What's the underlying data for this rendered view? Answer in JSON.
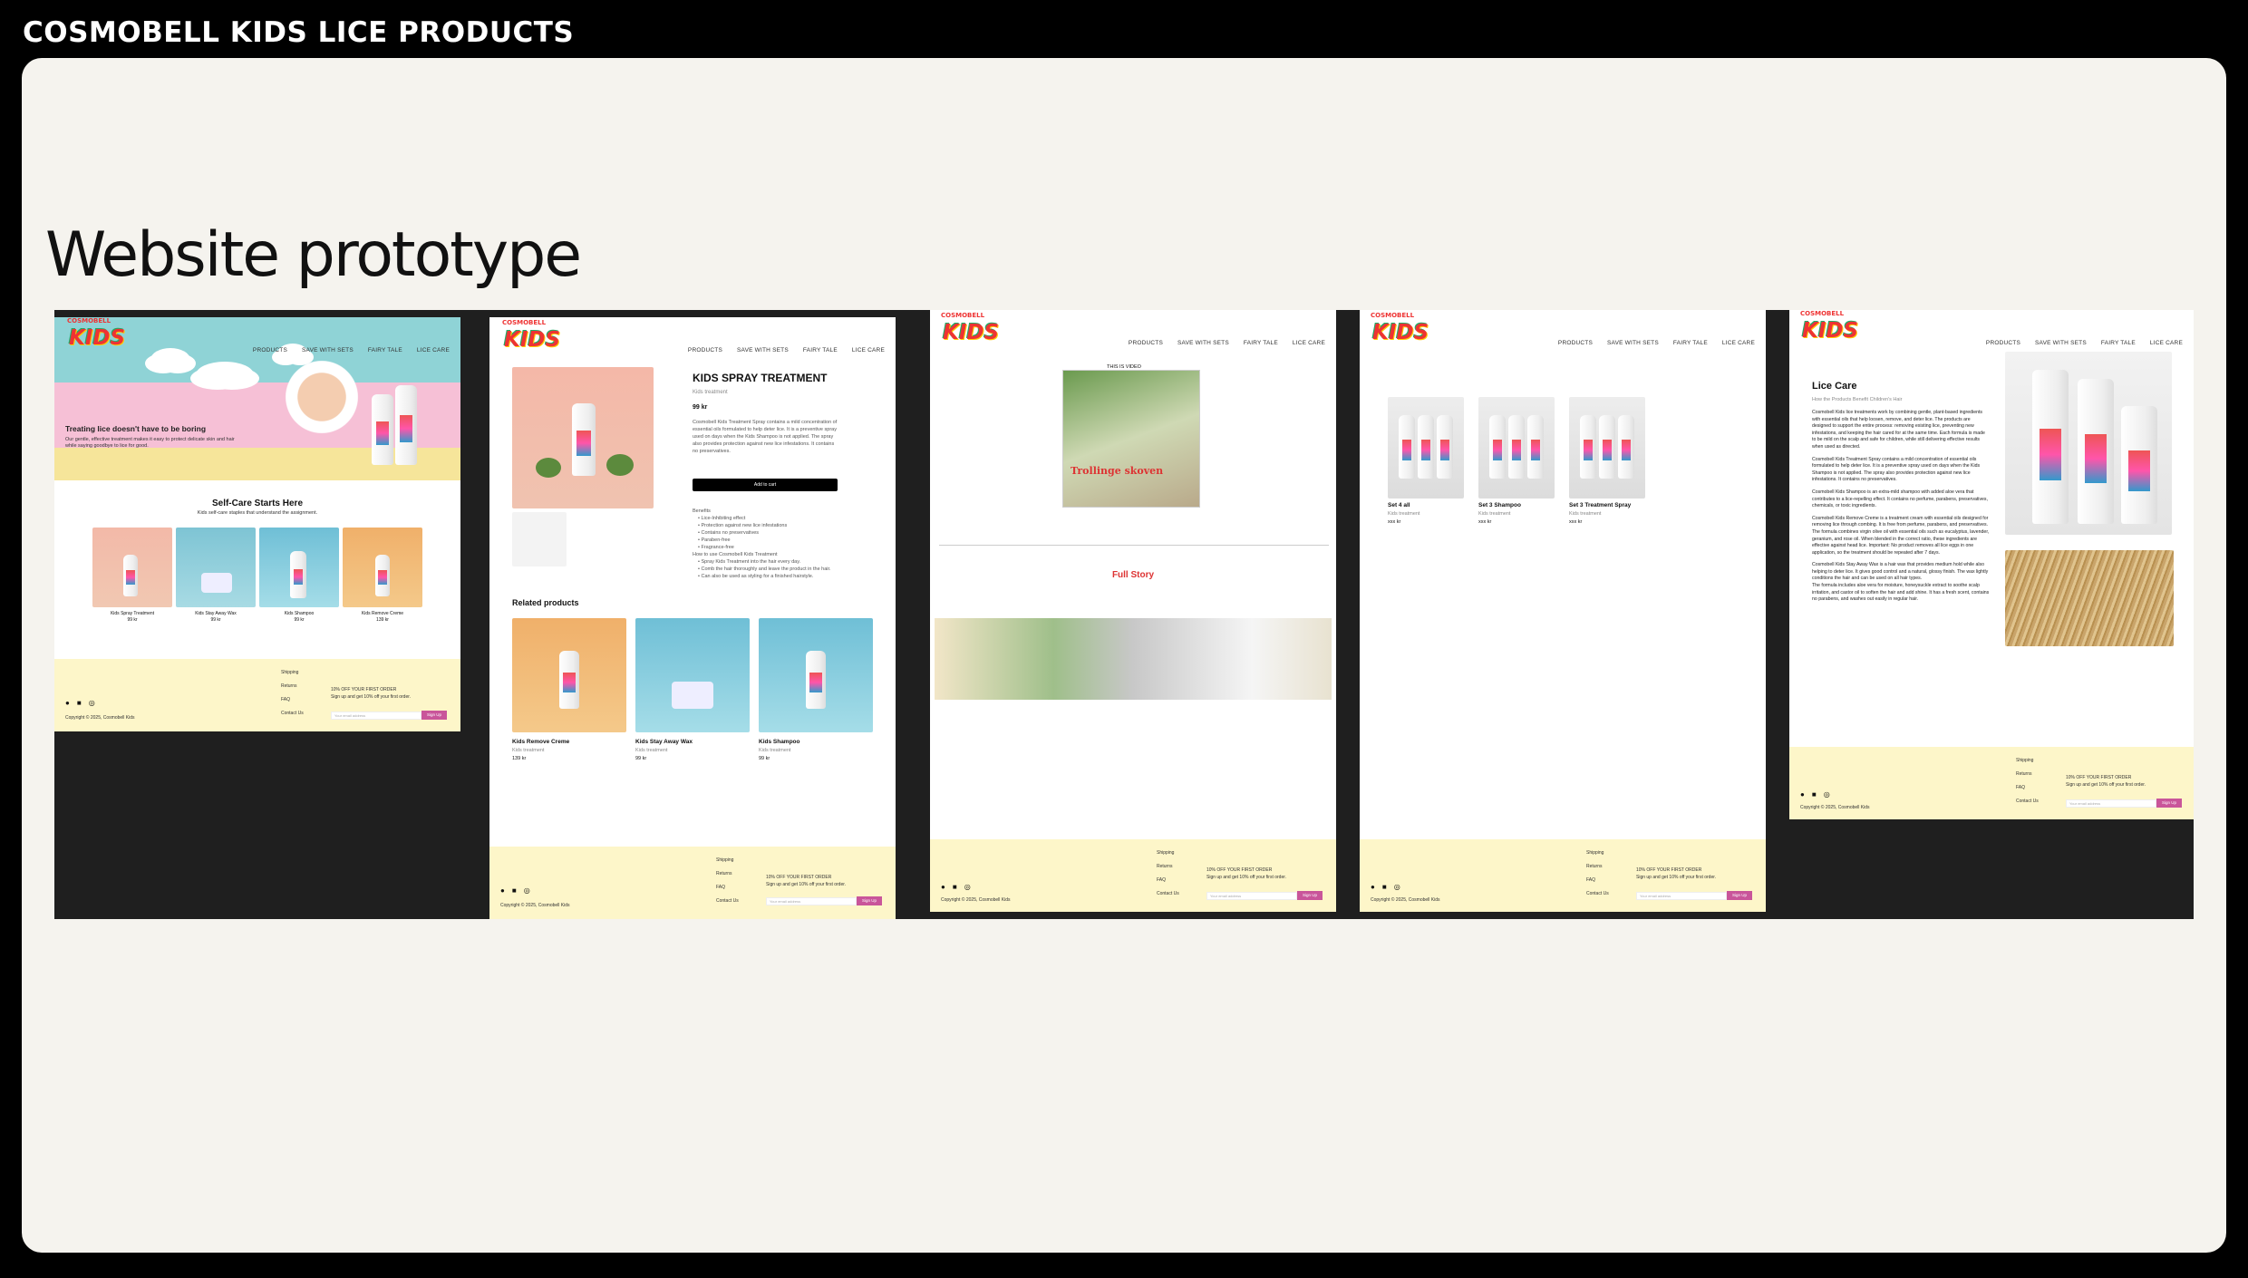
{
  "header": {
    "title": "COSMOBELL KIDS LICE PRODUCTS"
  },
  "section": {
    "heading": "Website prototype"
  },
  "colors": {
    "accent": "#c9559a",
    "footer": "#fdf6c9",
    "dark": "#1f1f1f",
    "panel": "#f5f3ee"
  },
  "common": {
    "logo": "KIDS",
    "logo_top": "COSMOBELL",
    "nav": [
      "PRODUCTS",
      "SAVE WITH SETS",
      "FAIRY TALE",
      "LICE CARE"
    ],
    "footer_links": [
      "Shipping",
      "Returns",
      "FAQ",
      "Contact Us"
    ],
    "footer_offer_title": "10% OFF YOUR FIRST ORDER",
    "footer_offer_text": "Sign up and get 10% off your first order.",
    "email_placeholder": "Your email address",
    "signup_label": "Sign Up",
    "copyright": "Copyright © 2025, Cosmobell Kids",
    "social_icons": [
      "facebook-icon",
      "linkedin-icon",
      "instagram-icon"
    ]
  },
  "home": {
    "hero_title": "Treating lice doesn't have to be boring",
    "hero_text": "Our gentle, effective treatment makes it easy to protect delicate skin and hair while saying goodbye to lice for good.",
    "section_title": "Self-Care Starts Here",
    "section_sub": "Kids self-care staples that understand the assignment.",
    "products": [
      {
        "name": "Kids Spray Treatment",
        "price": "99 kr"
      },
      {
        "name": "Kids Stay Away Wax",
        "price": "99 kr"
      },
      {
        "name": "Kids Shampoo",
        "price": "99 kr"
      },
      {
        "name": "Kids Remove Creme",
        "price": "139 kr"
      }
    ]
  },
  "product": {
    "title": "KIDS SPRAY TREATMENT",
    "subtitle": "Kids treatment",
    "price": "99 kr",
    "description": "Cosmobell Kids Treatment Spray contains a mild concentration of essential oils formulated to help deter lice. It is a preventive spray used on days when the Kids Shampoo is not applied. The spray also provides protection against new lice infestations. It contains no preservatives.",
    "add_to_cart": "Add to cart",
    "benefits_title": "Benefits",
    "benefits": [
      "Lice-Inhibiting effect",
      "Protection against new lice infestations",
      "Contains no preservatives",
      "Paraben-free",
      "Fragrance-free"
    ],
    "howto_title": "How to use Cosmobell Kids Treatment",
    "howto": [
      "Spray Kids Treatment into the hair every day.",
      "Comb the hair thoroughly and leave the product in the hair.",
      "Can also be used as styling for a finished hairstyle."
    ],
    "related_title": "Related products",
    "related": [
      {
        "name": "Kids Remove Creme",
        "sub": "Kids treatment",
        "price": "139 kr"
      },
      {
        "name": "Kids Stay Away Wax",
        "sub": "Kids treatment",
        "price": "99 kr"
      },
      {
        "name": "Kids Shampoo",
        "sub": "Kids treatment",
        "price": "99 kr"
      }
    ]
  },
  "fairy": {
    "video_label": "THIS IS VIDEO",
    "book_title": "Trollinge skoven",
    "full_story": "Full Story"
  },
  "sets": {
    "items": [
      {
        "name": "Set 4 all",
        "sub": "Kids treatment",
        "price": "xxx kr"
      },
      {
        "name": "Set 3 Shampoo",
        "sub": "Kids treatment",
        "price": "xxx kr"
      },
      {
        "name": "Set 3 Treatment Spray",
        "sub": "Kids treatment",
        "price": "xxx kr"
      }
    ]
  },
  "lice": {
    "title": "Lice Care",
    "subtitle": "How the Products Benefit Children's Hair",
    "paragraphs": [
      "Cosmobell Kids lice treatments work by combining gentle, plant-based ingredients with essential oils that help loosen, remove, and deter lice. The products are designed to support the entire process: removing existing lice, preventing new infestations, and keeping the hair cared for at the same time. Each formula is made to be mild on the scalp and safe for children, while still delivering effective results when used as directed.",
      "Cosmobell Kids Treatment Spray contains a mild concentration of essential oils formulated to help deter lice. It is a preventive spray used on days when the Kids Shampoo is not applied. The spray also provides protection against new lice infestations. It contains no preservatives.",
      "Cosmobell Kids Shampoo is an extra-mild shampoo with added aloe vera that contributes to a lice-repelling effect. It contains no perfume, parabens, preservatives, chemicals, or toxic ingredients.",
      "Cosmobell Kids Remove Creme is a treatment cream with essential oils designed for removing lice through combing. It is free from perfume, parabens, and preservatives. The formula combines virgin olive oil with essential oils such as eucalyptus, lavender, geranium, and rose oil. When blended in the correct ratio, these ingredients are effective against head lice. Important: No product removes all lice eggs in one application, so the treatment should be repeated after 7 days.",
      "Cosmobell Kids Stay Away Wax is a hair wax that provides medium hold while also helping to deter lice. It gives good control and a natural, glossy finish. The wax lightly conditions the hair and can be used on all hair types.",
      "The formula includes aloe vera for moisture, honeysuckle extract to soothe scalp irritation, and castor oil to soften the hair and add shine. It has a fresh scent, contains no parabens, and washes out easily in regular hair."
    ]
  }
}
